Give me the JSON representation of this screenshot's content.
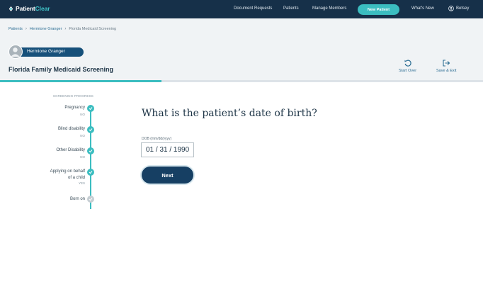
{
  "nav": {
    "logo_part1": "Patient",
    "logo_part2": "Clear",
    "links": [
      "Document Requests",
      "Patients",
      "Manage Members"
    ],
    "new_patient": "New Patient",
    "whats_new": "What's New",
    "user_name": "Betsey"
  },
  "breadcrumb": {
    "items": [
      "Patients",
      "Hermione Granger",
      "Florida Medicaid Screening"
    ]
  },
  "patient": {
    "name": "Hermione Granger"
  },
  "page_title": "Florida Family Medicaid Screening",
  "actions": {
    "start_over": "Start Over",
    "save_exit": "Save & Exit"
  },
  "progress": {
    "fraction": 0.335
  },
  "steps": {
    "heading": "SCREENING PROGRESS",
    "items": [
      {
        "label": "Pregnancy",
        "value": "NO",
        "status": "done"
      },
      {
        "label": "Blind disability",
        "value": "NO",
        "status": "done"
      },
      {
        "label": "Other Disability",
        "value": "NO",
        "status": "done"
      },
      {
        "label": "Applying on behalf of a child",
        "value": "YES",
        "status": "done"
      },
      {
        "label": "Born on",
        "value": "",
        "status": "pending"
      }
    ]
  },
  "question": {
    "text": "What is the patient’s date of birth?",
    "field_label": "DOB (mm/dd/yyyy)",
    "field_value": "01 / 31 / 1990",
    "next_label": "Next"
  },
  "colors": {
    "navy": "#163049",
    "teal": "#3bbdc0",
    "button": "#163f63"
  }
}
